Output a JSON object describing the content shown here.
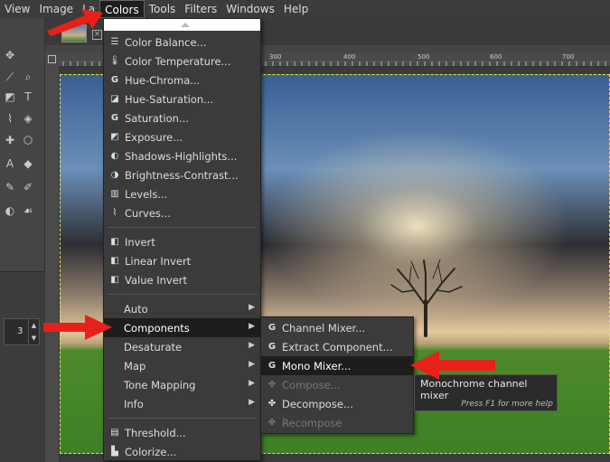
{
  "menubar": {
    "items": [
      "View",
      "Image",
      "La",
      "Colors",
      "Tools",
      "Filters",
      "Windows",
      "Help"
    ],
    "active": "Colors"
  },
  "colors_menu": {
    "group1": [
      {
        "label": "Color Balance...",
        "icon": "sliders-icon"
      },
      {
        "label": "Color Temperature...",
        "icon": "thermometer-icon"
      },
      {
        "label": "Hue-Chroma...",
        "icon": "gegl-icon"
      },
      {
        "label": "Hue-Saturation...",
        "icon": "hue-saturation-icon"
      },
      {
        "label": "Saturation...",
        "icon": "gegl-icon"
      },
      {
        "label": "Exposure...",
        "icon": "exposure-icon"
      },
      {
        "label": "Shadows-Highlights...",
        "icon": "shadows-highlights-icon"
      },
      {
        "label": "Brightness-Contrast...",
        "icon": "brightness-contrast-icon"
      },
      {
        "label": "Levels...",
        "icon": "levels-icon"
      },
      {
        "label": "Curves...",
        "icon": "curves-icon"
      }
    ],
    "group2": [
      {
        "label": "Invert",
        "icon": "invert-icon"
      },
      {
        "label": "Linear Invert",
        "icon": "invert-icon"
      },
      {
        "label": "Value Invert",
        "icon": "invert-icon"
      }
    ],
    "group3": [
      {
        "label": "Auto"
      },
      {
        "label": "Components"
      },
      {
        "label": "Desaturate"
      },
      {
        "label": "Map"
      },
      {
        "label": "Tone Mapping"
      },
      {
        "label": "Info"
      }
    ],
    "group4": [
      {
        "label": "Threshold...",
        "icon": "threshold-icon"
      },
      {
        "label": "Colorize...",
        "icon": "colorize-icon"
      }
    ]
  },
  "components_menu": {
    "items": [
      {
        "label": "Channel Mixer...",
        "enabled": true
      },
      {
        "label": "Extract Component...",
        "enabled": true
      },
      {
        "label": "Mono Mixer...",
        "enabled": true
      },
      {
        "label": "Compose...",
        "enabled": false
      },
      {
        "label": "Decompose...",
        "enabled": true
      },
      {
        "label": "Recompose",
        "enabled": false
      }
    ]
  },
  "tooltip": {
    "text": "Monochrome channel mixer",
    "hint": "Press F1 for more help"
  },
  "ruler": {
    "labels": [
      "300",
      "400",
      "500",
      "600",
      "700"
    ]
  },
  "spin": {
    "value": "3"
  },
  "colors": {
    "annotation_red": "#e8201a",
    "highlight": "#1d1d1d"
  }
}
